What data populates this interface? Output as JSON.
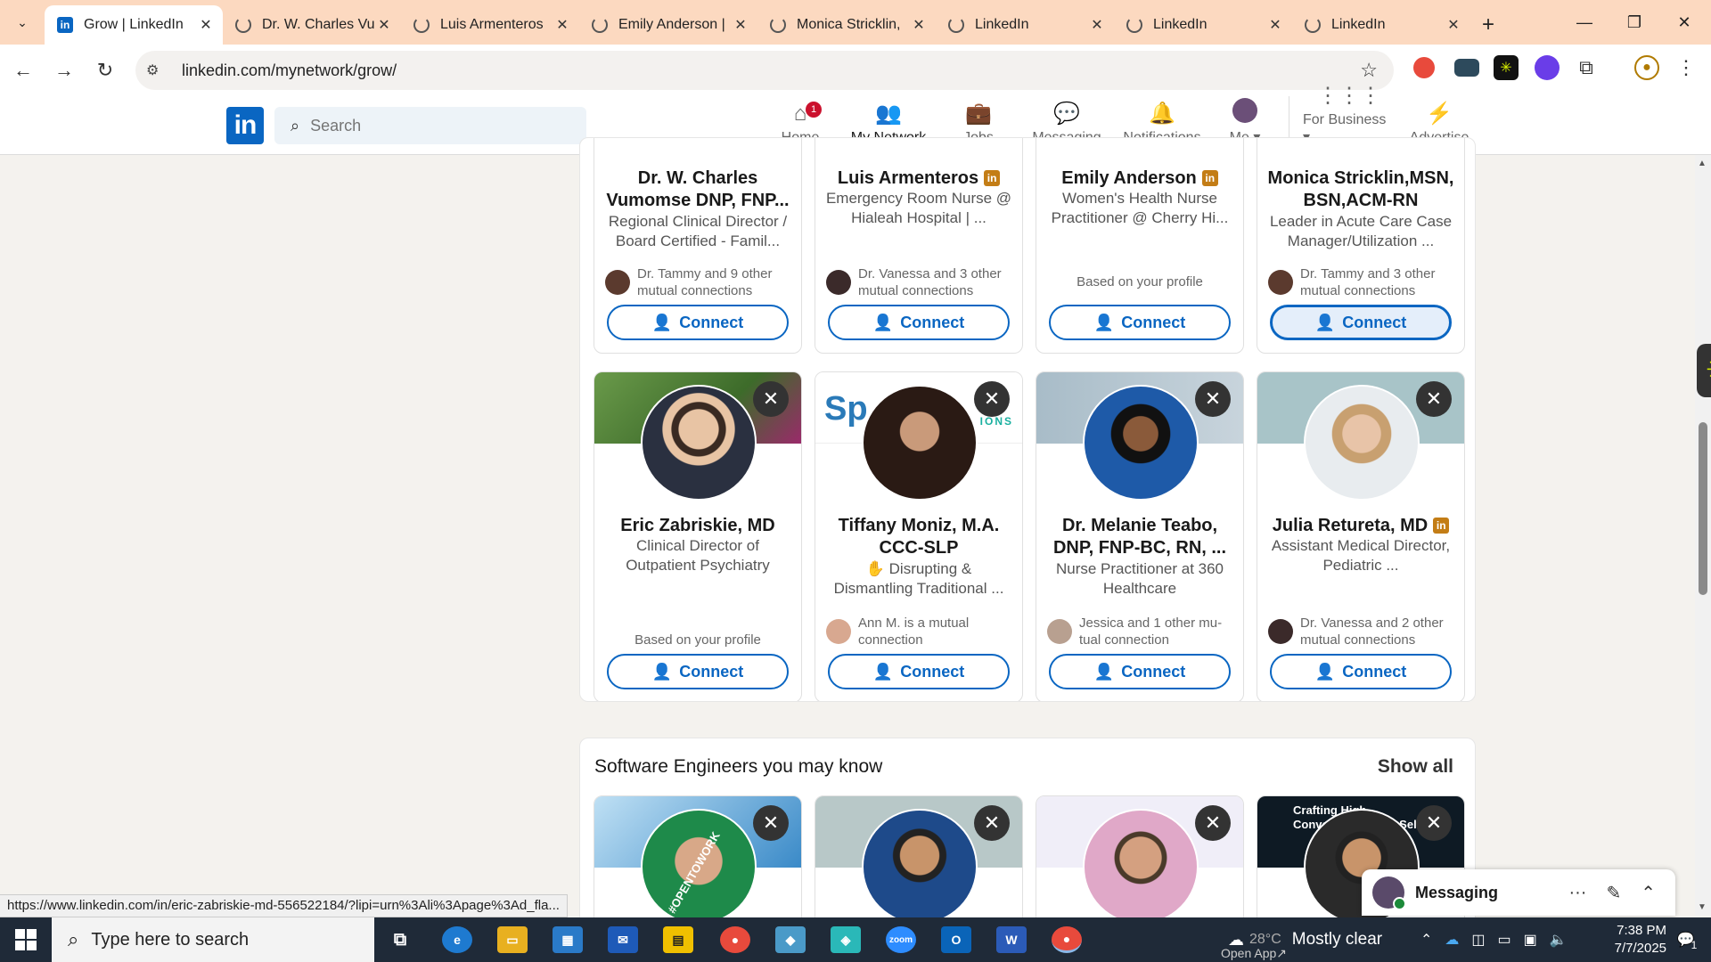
{
  "browser": {
    "tabs": [
      {
        "title": "Grow | LinkedIn",
        "icon": "linkedin-icon",
        "active": true
      },
      {
        "title": "Dr. W. Charles Vu",
        "icon": "loading-icon"
      },
      {
        "title": "Luis Armenteros",
        "icon": "loading-icon"
      },
      {
        "title": "Emily Anderson |",
        "icon": "loading-icon"
      },
      {
        "title": "Monica Stricklin,",
        "icon": "loading-icon"
      },
      {
        "title": "LinkedIn",
        "icon": "loading-icon"
      },
      {
        "title": "LinkedIn",
        "icon": "loading-icon"
      },
      {
        "title": "LinkedIn",
        "icon": "loading-icon"
      }
    ],
    "url": "linkedin.com/mynetwork/grow/",
    "status_url": "https://www.linkedin.com/in/eric-zabriskie-md-556522184/?lipi=urn%3Ali%3Apage%3Ad_fla..."
  },
  "linkedin": {
    "search_placeholder": "Search",
    "nav": [
      {
        "label": "Home",
        "icon": "home-icon",
        "badge": "1"
      },
      {
        "label": "My Network",
        "icon": "network-icon",
        "active": true
      },
      {
        "label": "Jobs",
        "icon": "briefcase-icon"
      },
      {
        "label": "Messaging",
        "icon": "messaging-icon"
      },
      {
        "label": "Notifications",
        "icon": "bell-icon"
      },
      {
        "label": "Me",
        "icon": "avatar"
      },
      {
        "label": "For Business",
        "icon": "grid-icon"
      },
      {
        "label": "Advertise",
        "icon": "advertise-icon"
      }
    ]
  },
  "row1": [
    {
      "name": "Dr. W. Charles Vumomse DNP, FNP...",
      "headline": "Regional Clinical Director / Board Certified - Famil...",
      "mutual": "Dr. Tammy and 9 other mutual connections",
      "connect": "Connect"
    },
    {
      "name": "Luis Armenteros",
      "headline": "Emergency Room Nurse @ Hialeah Hospital | ...",
      "mutual": "Dr. Vanessa and 3 other mutual connections",
      "connect": "Connect"
    },
    {
      "name": "Emily Anderson",
      "headline": "Women's Health Nurse Practitioner @ Cherry Hi...",
      "based": "Based on your profile",
      "connect": "Connect"
    },
    {
      "name": "Monica Stricklin,MSN, BSN,ACM-RN",
      "headline": "Leader in Acute Care Case Manager/Utilization ...",
      "mutual": "Dr. Tammy and 3 other mutual connections",
      "connect": "Connect"
    }
  ],
  "row2": [
    {
      "name": "Eric Zabriskie, MD",
      "headline": "Clinical Director of Outpatient Psychiatry",
      "based": "Based on your profile",
      "connect": "Connect"
    },
    {
      "name": "Tiffany Moniz, M.A. CCC-SLP",
      "headline": "✋ Disrupting & Dismantling Traditional ...",
      "mutual": "Ann M. is a mutual connection",
      "connect": "Connect"
    },
    {
      "name": "Dr. Melanie Teabo, DNP, FNP-BC, RN, ...",
      "headline": "Nurse Practitioner at 360 Healthcare",
      "mutual": "Jessica and 1 other mu- tual connection",
      "connect": "Connect"
    },
    {
      "name": "Julia Retureta, MD",
      "headline": "Assistant Medical Director, Pediatric ...",
      "mutual": "Dr. Vanessa and 2 other mutual connections",
      "connect": "Connect"
    }
  ],
  "section2": {
    "title": "Software Engineers you may know",
    "show_all": "Show all",
    "banner4_text": "Crafting High-Converting Shop... Sel...",
    "banner1_text": "#OPENTOWORK"
  },
  "messaging": {
    "label": "Messaging"
  },
  "taskbar": {
    "search_placeholder": "Type here to search",
    "weather_temp": "28°C",
    "weather": "Mostly clear",
    "time": "7:38 PM",
    "date": "7/7/2025",
    "open_app": "Open App",
    "notif_count": "1"
  }
}
